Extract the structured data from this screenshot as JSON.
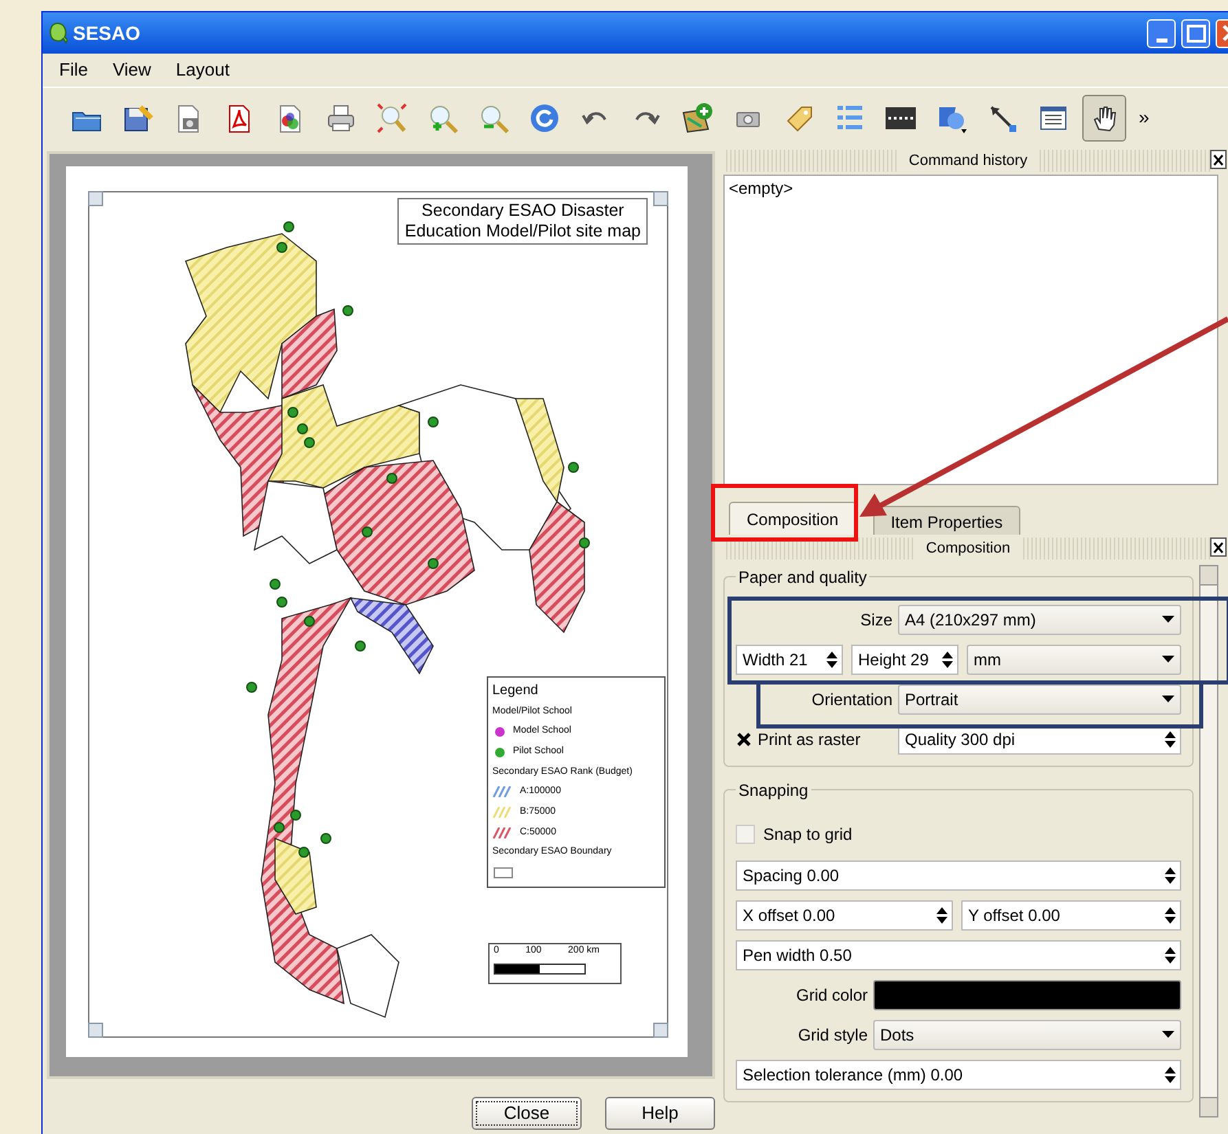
{
  "window": {
    "title": "SESAO"
  },
  "menu": [
    {
      "label": "File"
    },
    {
      "label": "View"
    },
    {
      "label": "Layout"
    }
  ],
  "toolbar": {
    "tools": [
      {
        "kind": "open",
        "selected": false
      },
      {
        "kind": "save",
        "selected": false
      },
      {
        "kind": "export_image",
        "selected": false
      },
      {
        "kind": "pdf",
        "selected": false
      },
      {
        "kind": "svg",
        "selected": false
      },
      {
        "kind": "print",
        "selected": false
      },
      {
        "kind": "zoom_full",
        "selected": false
      },
      {
        "kind": "zoom_in",
        "selected": false
      },
      {
        "kind": "zoom_out",
        "selected": false
      },
      {
        "kind": "refresh",
        "selected": false
      },
      {
        "kind": "undo",
        "selected": false
      },
      {
        "kind": "redo",
        "selected": false
      },
      {
        "kind": "add_map",
        "selected": false
      },
      {
        "kind": "add_image",
        "selected": false
      },
      {
        "kind": "add_label",
        "selected": false
      },
      {
        "kind": "add_legend",
        "selected": false
      },
      {
        "kind": "add_scalebar",
        "selected": false
      },
      {
        "kind": "add_shape",
        "selected": false
      },
      {
        "kind": "add_arrow",
        "selected": false
      },
      {
        "kind": "add_table",
        "selected": false
      },
      {
        "kind": "pan",
        "selected": true
      }
    ],
    "overflow": "»"
  },
  "page": {
    "title": [
      "Secondary ESAO Disaster",
      "Education Model/Pilot site map"
    ],
    "legend": {
      "title": "Legend",
      "items": [
        {
          "kind": "heading",
          "label": "Model/Pilot School"
        },
        {
          "kind": "dot",
          "color": "#cc33cc",
          "label": "Model School"
        },
        {
          "kind": "dot",
          "color": "#33aa33",
          "label": "Pilot School"
        },
        {
          "kind": "heading",
          "label": "Secondary ESAO Rank (Budget)"
        },
        {
          "kind": "hatch",
          "color": "#6f9fe0",
          "label": "A:100000"
        },
        {
          "kind": "hatch",
          "color": "#eedd77",
          "label": "B:75000"
        },
        {
          "kind": "hatch",
          "color": "#dd5566",
          "label": "C:50000"
        },
        {
          "kind": "heading",
          "label": "Secondary ESAO Boundary"
        },
        {
          "kind": "boundary"
        }
      ]
    },
    "scale_bar": {
      "labels": [
        "0",
        "100",
        "200 km"
      ]
    }
  },
  "buttons": [
    {
      "label": "Close",
      "focused": true
    },
    {
      "label": "Help",
      "focused": false
    }
  ],
  "command_history": {
    "title": "Command history",
    "items": [
      "<empty>"
    ]
  },
  "tabs": [
    {
      "label": "Composition",
      "selected": true
    },
    {
      "label": "Item Properties",
      "selected": false
    }
  ],
  "composition": {
    "title": "Composition",
    "paper": {
      "title": "Paper and quality",
      "size_label": "Size",
      "size": "A4 (210x297 mm)",
      "width": "Width 21",
      "height": "Height 29",
      "units": "mm",
      "orientation_label": "Orientation",
      "orientation": "Portrait",
      "print_as_raster": {
        "label": "Print as raster",
        "checked": true
      },
      "quality": "Quality 300 dpi"
    },
    "snapping": {
      "title": "Snapping",
      "snap_to_grid": {
        "label": "Snap to grid",
        "checked": false
      },
      "spacing": "Spacing 0.00",
      "x_offset": "X offset 0.00",
      "y_offset": "Y offset 0.00",
      "pen_width": "Pen width 0.50",
      "grid_color": {
        "label": "Grid color",
        "color": "#000000"
      },
      "grid_style_label": "Grid style",
      "grid_style": "Dots",
      "selection_tolerance": "Selection tolerance (mm) 0.00"
    }
  }
}
